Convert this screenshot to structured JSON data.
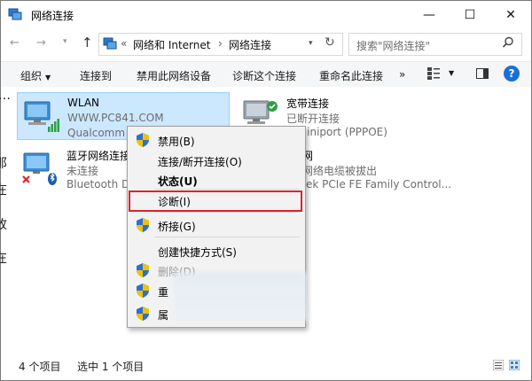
{
  "window": {
    "title": "网络连接",
    "min_glyph": "—",
    "max_glyph": "☐",
    "close_glyph": "✕"
  },
  "address": {
    "back_glyph": "←",
    "forward_glyph": "→",
    "recent_glyph": "▾",
    "up_glyph": "↑",
    "overflow": "«",
    "crumbs": [
      "网络和 Internet",
      "网络连接"
    ],
    "crumb_sep": "›",
    "dropdown_glyph": "▾",
    "refresh_glyph": "↻",
    "search_placeholder": "搜索\"网络连接\""
  },
  "toolbar": {
    "organize": "组织",
    "connect_to": "连接到",
    "disable_device": "禁用此网络设备",
    "diagnose": "诊断这个连接",
    "rename": "重命名此连接",
    "more": "»",
    "help": "?"
  },
  "connections": [
    {
      "name": "WLAN",
      "status": "WWW.PC841.COM",
      "device": "Qualcomm",
      "selected": true
    },
    {
      "name": "宽带连接",
      "status": "已断开连接",
      "device": "N Miniport (PPPOE)",
      "selected": false
    },
    {
      "name": "蓝牙网络连接",
      "status": "未连接",
      "device": "Bluetooth D",
      "selected": false
    },
    {
      "name": "网",
      "status": "网络电缆被拔出",
      "device": "ltek PCIe FE Family Control...",
      "selected": false
    }
  ],
  "context_menu": {
    "items": [
      {
        "label": "禁用(B)",
        "shield": true,
        "bold": false,
        "disabled": false
      },
      {
        "label": "连接/断开连接(O)",
        "shield": false,
        "bold": false,
        "disabled": false
      },
      {
        "label": "状态(U)",
        "shield": false,
        "bold": true,
        "disabled": false
      },
      {
        "label": "诊断(I)",
        "shield": false,
        "bold": false,
        "disabled": false,
        "highlighted": true
      },
      {
        "label": "桥接(G)",
        "shield": true,
        "bold": false,
        "disabled": false
      },
      {
        "label": "创建快捷方式(S)",
        "shield": false,
        "bold": false,
        "disabled": false
      },
      {
        "label": "删除(D)",
        "shield": true,
        "bold": false,
        "disabled": true
      },
      {
        "label": "重",
        "shield": true,
        "bold": false,
        "disabled": false
      },
      {
        "label": "属",
        "shield": true,
        "bold": false,
        "disabled": false
      }
    ],
    "highlight_color": "#d9252c"
  },
  "statusbar": {
    "item_count": "4 个项目",
    "selected_count": "选中 1 个项目"
  },
  "page_edge_fragments": [
    "…",
    "那",
    "在",
    "改",
    "在"
  ],
  "colors": {
    "selection": "#cce8ff",
    "selection_border": "#99d1ff",
    "help_blue": "#1a6fd6"
  }
}
